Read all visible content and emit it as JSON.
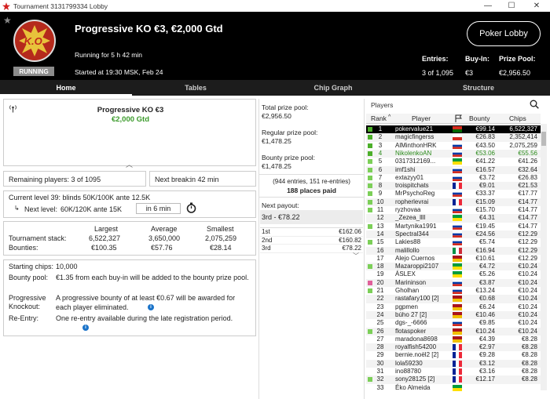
{
  "window": {
    "title": "Tournament 3131799334 Lobby",
    "minimize": "—",
    "maximize": "☐",
    "close": "✕"
  },
  "header": {
    "badge_text": "K.O.",
    "status": "RUNNING",
    "title": "Progressive KO €3, €2,000 Gtd",
    "running_for": "Running for 5 h 42 min",
    "started_at": "Started at 19:30 MSK, Feb 24",
    "lobby_button": "Poker Lobby",
    "entries_label": "Entries:",
    "entries_value": "3 of 1,095",
    "buyin_label": "Buy-In:",
    "buyin_value": "€3",
    "prizepool_label": "Prize Pool:",
    "prizepool_value": "€2,956.50"
  },
  "tabs": [
    "Home",
    "Tables",
    "Chip Graph",
    "Structure"
  ],
  "left": {
    "title": "Progressive KO €3",
    "prize": "€2,000 Gtd",
    "remaining": "Remaining players: 3 of 1095",
    "next_break_label": "Next break:",
    "next_break_value": "in 42 min",
    "current_level": "Current level 39:  blinds 50K/100K ante 12.5K",
    "next_level_label": "Next level:",
    "next_level_value": "60K/120K ante 15K",
    "next_level_time": "in 6 min",
    "stats_headers": [
      "Largest",
      "Average",
      "Smallest"
    ],
    "stack_label": "Tournament stack:",
    "stack_values": [
      "6,522,327",
      "3,650,000",
      "2,075,259"
    ],
    "bounty_label": "Bounties:",
    "bounty_values": [
      "€100.35",
      "€57.76",
      "€28.14"
    ],
    "starting_chips_label": "Starting chips:",
    "starting_chips_value": "10,000",
    "bounty_pool_label": "Bounty pool:",
    "bounty_pool_value": "€1.35 from each buy-in will be added to the bounty prize pool.",
    "prog_ko_label1": "Progressive",
    "prog_ko_label2": "Knockout:",
    "prog_ko_value": "A progressive bounty of at least €0.67 will be awarded for each player eliminated.",
    "reentry_label": "Re-Entry:",
    "reentry_value": "One re-entry available during the late registration period."
  },
  "middle": {
    "total_label": "Total prize pool:",
    "total_value": "€2,956.50",
    "regular_label": "Regular prize pool:",
    "regular_value": "€1,478.25",
    "bounty_label": "Bounty prize pool:",
    "bounty_value": "€1,478.25",
    "entries_note": "(944 entries, 151 re-entries)",
    "places_paid": "188 places paid",
    "next_payout_label": "Next payout:",
    "next_payout_value": "3rd - €78.22",
    "payouts": [
      {
        "place": "1st",
        "amount": "€162.06"
      },
      {
        "place": "2nd",
        "amount": "€160.82"
      },
      {
        "place": "3rd",
        "amount": "€78.22"
      }
    ]
  },
  "players": {
    "search_label": "Players",
    "headers": {
      "rank": "Rank",
      "player": "Player",
      "bounty": "Bounty",
      "chips": "Chips"
    },
    "rows": [
      {
        "rank": "1",
        "name": "pokervalue21",
        "bounty": "€99.14",
        "chips": "6,522,327",
        "status": "active",
        "flag": [
          "#d52b1e",
          "#006600"
        ]
      },
      {
        "rank": "2",
        "name": "magicfingerss",
        "bounty": "€26.83",
        "chips": "2,352,414",
        "status": "active",
        "flag": [
          "#ffffff",
          "#d52b1e"
        ]
      },
      {
        "rank": "3",
        "name": "AlMinthonHRK",
        "bounty": "€43.50",
        "chips": "2,075,259",
        "status": "active",
        "flag": [
          "#ffffff",
          "#0039a6",
          "#d52b1e"
        ]
      },
      {
        "rank": "4",
        "name": "NikolenkoAN",
        "bounty": "€53.06",
        "chips": "€55.56",
        "status": "out-green",
        "flag": [
          "#ffffff",
          "#0039a6",
          "#d52b1e"
        ]
      },
      {
        "rank": "5",
        "name": "0317312169...",
        "bounty": "€41.22",
        "chips": "€41.26",
        "status": "out",
        "flag": [
          "#009c3b",
          "#fedf00"
        ]
      },
      {
        "rank": "6",
        "name": "imf1shi",
        "bounty": "€16.57",
        "chips": "€32.64",
        "status": "out",
        "flag": [
          "#ffffff",
          "#0039a6",
          "#d52b1e"
        ]
      },
      {
        "rank": "7",
        "name": "extazyy01",
        "bounty": "€3.72",
        "chips": "€26.83",
        "status": "out",
        "flag": [
          "#ffffff",
          "#0039a6",
          "#d52b1e"
        ]
      },
      {
        "rank": "8",
        "name": "troispitchats",
        "bounty": "€9.01",
        "chips": "€21.53",
        "status": "out",
        "flag": [
          "#002395",
          "#ffffff",
          "#ed2939"
        ]
      },
      {
        "rank": "9",
        "name": "MrPsychoReg",
        "bounty": "€33.37",
        "chips": "€17.77",
        "status": "out",
        "flag": [
          "#ffffff",
          "#0039a6",
          "#d52b1e"
        ]
      },
      {
        "rank": "10",
        "name": "ropherlevrai",
        "bounty": "€15.09",
        "chips": "€14.77",
        "status": "out",
        "flag": [
          "#002395",
          "#ffffff",
          "#ed2939"
        ]
      },
      {
        "rank": "11",
        "name": "ryzhovaa",
        "bounty": "€15.70",
        "chips": "€14.77",
        "status": "out",
        "flag": [
          "#ffffff",
          "#0039a6",
          "#d52b1e"
        ]
      },
      {
        "rank": "12",
        "name": "_Zezea_llll",
        "bounty": "€4.31",
        "chips": "€14.77",
        "status": "none",
        "flag": [
          "#009c3b",
          "#fedf00"
        ]
      },
      {
        "rank": "13",
        "name": "Martynika1991",
        "bounty": "€19.45",
        "chips": "€14.77",
        "status": "out",
        "flag": [
          "#ffffff",
          "#0039a6",
          "#d52b1e"
        ]
      },
      {
        "rank": "14",
        "name": "Spectral344",
        "bounty": "€24.56",
        "chips": "€12.29",
        "status": "none",
        "flag": [
          "#ffffff",
          "#0039a6",
          "#d52b1e"
        ]
      },
      {
        "rank": "15",
        "name": "Lakies88",
        "bounty": "€5.74",
        "chips": "€12.29",
        "status": "out",
        "flag": [
          "#ffffff",
          "#0039a6",
          "#d52b1e"
        ]
      },
      {
        "rank": "16",
        "name": "malillollo",
        "bounty": "€16.94",
        "chips": "€12.29",
        "status": "none",
        "flag": [
          "#009246",
          "#ffffff",
          "#ce2b37"
        ]
      },
      {
        "rank": "17",
        "name": "Alejo Cuernos",
        "bounty": "€10.61",
        "chips": "€12.29",
        "status": "none",
        "flag": [
          "#aa151b",
          "#f1bf00"
        ]
      },
      {
        "rank": "18",
        "name": "Mazaroppi2107",
        "bounty": "€4.72",
        "chips": "€10.24",
        "status": "out",
        "flag": [
          "#009c3b",
          "#fedf00"
        ]
      },
      {
        "rank": "19",
        "name": "ÁSLEX",
        "bounty": "€5.26",
        "chips": "€10.24",
        "status": "none",
        "flag": [
          "#009c3b",
          "#fedf00"
        ]
      },
      {
        "rank": "20",
        "name": "Marininson",
        "bounty": "€3.87",
        "chips": "€10.24",
        "status": "pink",
        "flag": [
          "#ffffff",
          "#0039a6",
          "#d52b1e"
        ]
      },
      {
        "rank": "21",
        "name": "Gholhan",
        "bounty": "€13.24",
        "chips": "€10.24",
        "status": "out",
        "flag": [
          "#ffffff",
          "#0039a6",
          "#d52b1e"
        ]
      },
      {
        "rank": "22",
        "name": "rastafary100 [2]",
        "bounty": "€0.68",
        "chips": "€10.24",
        "status": "none",
        "flag": [
          "#aa151b",
          "#f1bf00"
        ]
      },
      {
        "rank": "23",
        "name": "pgpmen",
        "bounty": "€6.24",
        "chips": "€10.24",
        "status": "none",
        "flag": [
          "#aa151b",
          "#f1bf00"
        ]
      },
      {
        "rank": "24",
        "name": "búho 27 [2]",
        "bounty": "€10.46",
        "chips": "€10.24",
        "status": "none",
        "flag": [
          "#aa151b",
          "#f1bf00"
        ]
      },
      {
        "rank": "25",
        "name": "dgs-_-6666",
        "bounty": "€9.85",
        "chips": "€10.24",
        "status": "none",
        "flag": [
          "#ffffff",
          "#0039a6",
          "#d52b1e"
        ]
      },
      {
        "rank": "26",
        "name": "flotaspoker",
        "bounty": "€10.24",
        "chips": "€10.24",
        "status": "out",
        "flag": [
          "#aa151b",
          "#f1bf00"
        ]
      },
      {
        "rank": "27",
        "name": "maradona8698",
        "bounty": "€4.39",
        "chips": "€8.28",
        "status": "none",
        "flag": [
          "#aa151b",
          "#f1bf00"
        ]
      },
      {
        "rank": "28",
        "name": "royalfish54200",
        "bounty": "€2.97",
        "chips": "€8.28",
        "status": "none",
        "flag": [
          "#002395",
          "#ffffff",
          "#ed2939"
        ]
      },
      {
        "rank": "29",
        "name": "bernie.noël2 [2]",
        "bounty": "€9.28",
        "chips": "€8.28",
        "status": "none",
        "flag": [
          "#002395",
          "#ffffff",
          "#ed2939"
        ]
      },
      {
        "rank": "30",
        "name": "lola59230",
        "bounty": "€3.12",
        "chips": "€8.28",
        "status": "none",
        "flag": [
          "#002395",
          "#ffffff",
          "#ed2939"
        ]
      },
      {
        "rank": "31",
        "name": "ino88780",
        "bounty": "€3.16",
        "chips": "€8.28",
        "status": "none",
        "flag": [
          "#002395",
          "#ffffff",
          "#ed2939"
        ]
      },
      {
        "rank": "32",
        "name": "sony28125 [2]",
        "bounty": "€12.17",
        "chips": "€8.28",
        "status": "out",
        "flag": [
          "#002395",
          "#ffffff",
          "#ed2939"
        ]
      },
      {
        "rank": "33",
        "name": "Éko Almeida",
        "bounty": "",
        "chips": "",
        "status": "none",
        "flag": [
          "#009c3b",
          "#fedf00"
        ]
      }
    ]
  },
  "colors": {
    "header_bg": "#000000",
    "tab_bg": "#1c1c1c",
    "accent_green": "#3a9a2a",
    "highlight_row": "#000000"
  }
}
